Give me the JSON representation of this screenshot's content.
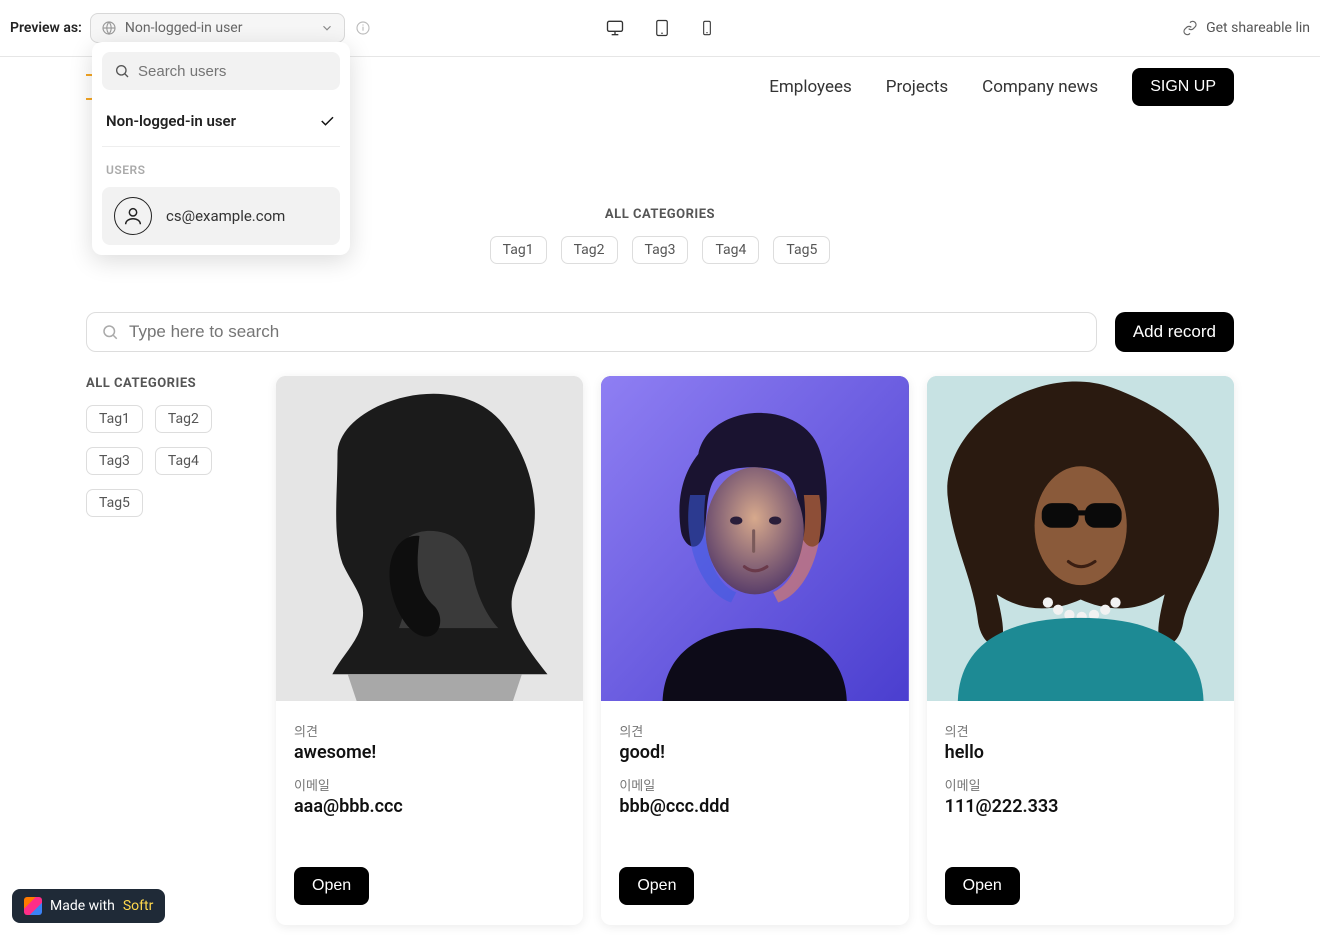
{
  "preview": {
    "label": "Preview as:",
    "selected": "Non-logged-in user",
    "share_label": "Get shareable lin",
    "dropdown": {
      "search_placeholder": "Search users",
      "selected_option": "Non-logged-in user",
      "section_label": "USERS",
      "user_email": "cs@example.com"
    }
  },
  "site": {
    "nav": {
      "employees": "Employees",
      "projects": "Projects",
      "news": "Company news"
    },
    "signup": "SIGN UP"
  },
  "hero": {
    "label": "ALL CATEGORIES",
    "tags": [
      "Tag1",
      "Tag2",
      "Tag3",
      "Tag4",
      "Tag5"
    ]
  },
  "search": {
    "placeholder": "Type here to search",
    "add_label": "Add record"
  },
  "sidecats": {
    "label": "ALL CATEGORIES",
    "tags": [
      "Tag1",
      "Tag2",
      "Tag3",
      "Tag4",
      "Tag5"
    ]
  },
  "cards": [
    {
      "opinion_label": "의견",
      "opinion": "awesome!",
      "email_label": "이메일",
      "email": "aaa@bbb.ccc",
      "open": "Open"
    },
    {
      "opinion_label": "의견",
      "opinion": "good!",
      "email_label": "이메일",
      "email": "bbb@ccc.ddd",
      "open": "Open"
    },
    {
      "opinion_label": "의견",
      "opinion": "hello",
      "email_label": "이메일",
      "email": "111@222.333",
      "open": "Open"
    }
  ],
  "badge": {
    "prefix": "Made with ",
    "brand": "Softr"
  }
}
